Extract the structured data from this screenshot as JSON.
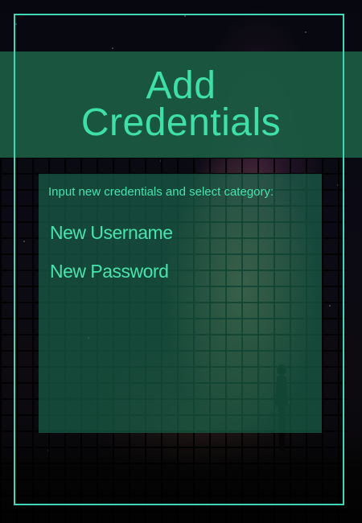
{
  "header": {
    "title_line1": "Add",
    "title_line2": "Credentials"
  },
  "form": {
    "prompt": "Input new credentials and select category:",
    "username": {
      "placeholder": "New Username",
      "value": ""
    },
    "password": {
      "placeholder": "New Password",
      "value": ""
    }
  },
  "colors": {
    "accent": "#3fe0a8",
    "frame": "#3fd7b8",
    "band": "#1b6046"
  },
  "icons": {
    "background": "starry-sky-grid-image",
    "figure": "person-silhouette-icon"
  }
}
